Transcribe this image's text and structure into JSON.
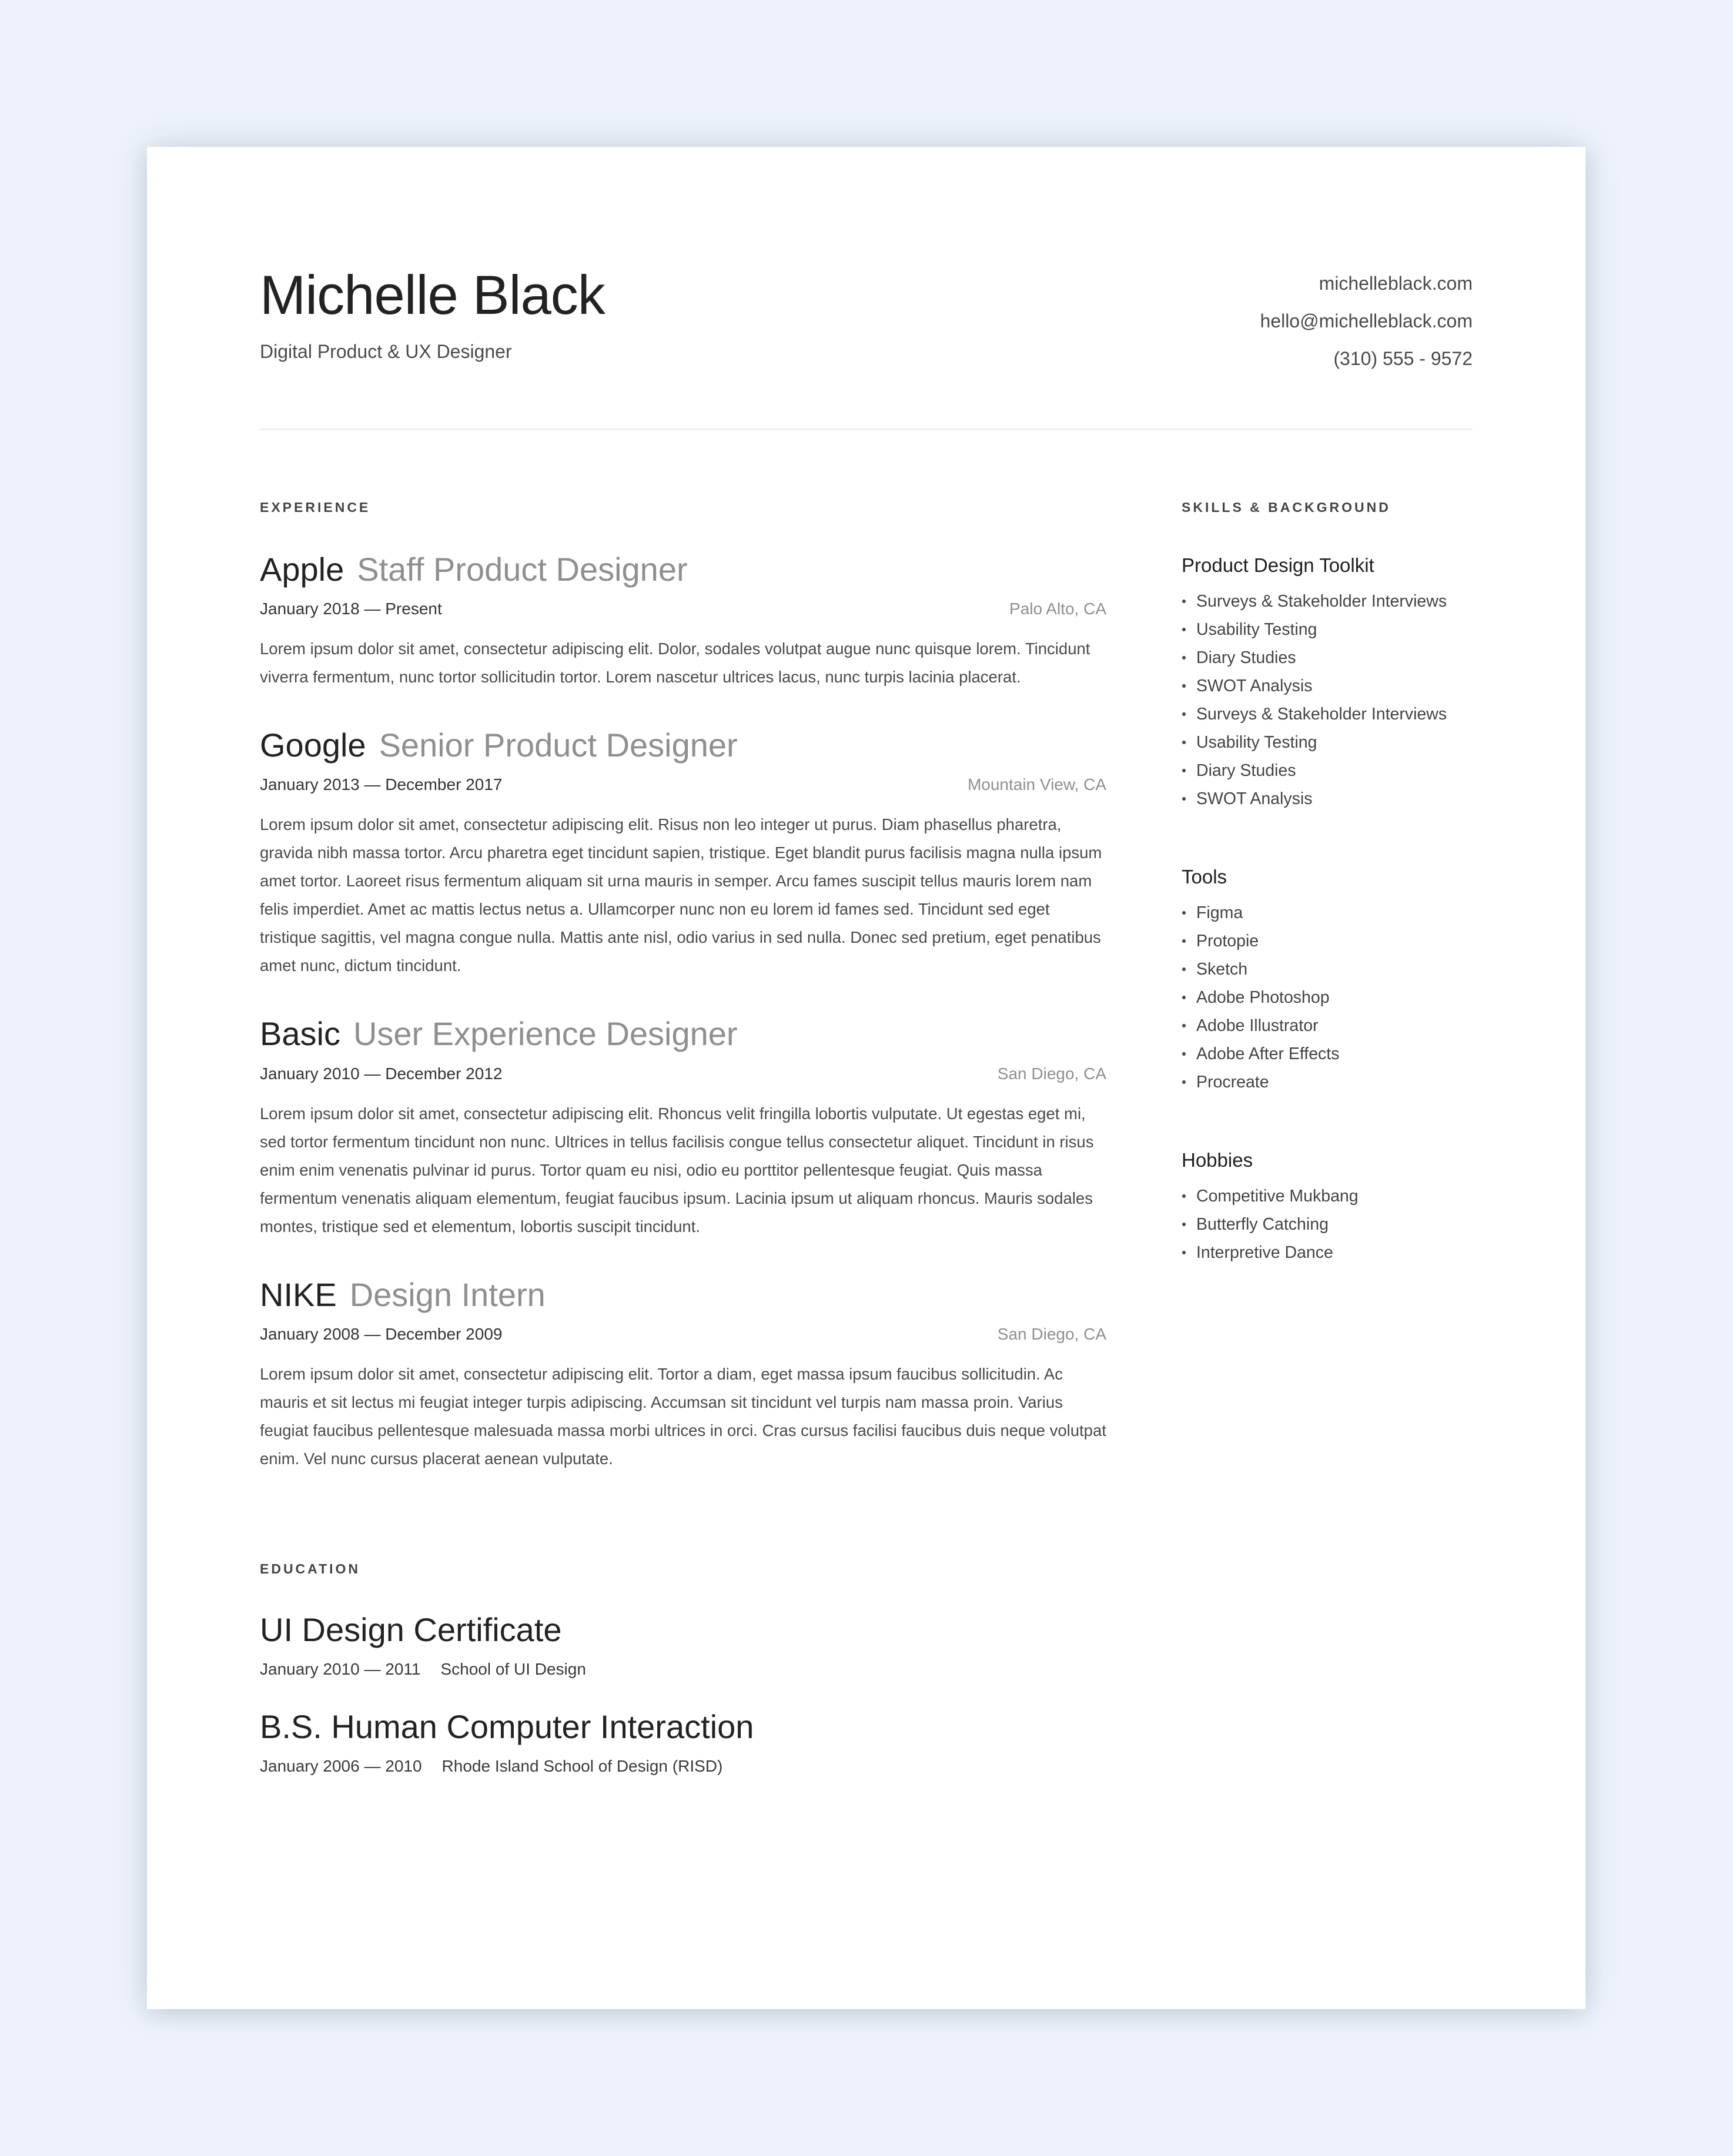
{
  "header": {
    "name": "Michelle Black",
    "subtitle": "Digital Product & UX Designer",
    "contact": {
      "website": "michelleblack.com",
      "email": "hello@michelleblack.com",
      "phone": "(310) 555 - 9572"
    }
  },
  "experience": {
    "label": "Experience",
    "jobs": [
      {
        "company": "Apple",
        "role": "Staff Product Designer",
        "dates": "January 2018 — Present",
        "location": "Palo Alto, CA",
        "description": "Lorem ipsum dolor sit amet, consectetur adipiscing elit. Dolor, sodales volutpat augue nunc quisque lorem. Tincidunt viverra fermentum, nunc tortor sollicitudin tortor. Lorem nascetur ultrices lacus, nunc turpis lacinia placerat."
      },
      {
        "company": "Google",
        "role": "Senior Product Designer",
        "dates": "January 2013 — December 2017",
        "location": "Mountain View, CA",
        "description": "Lorem ipsum dolor sit amet, consectetur adipiscing elit. Risus non leo integer ut purus. Diam phasellus pharetra, gravida nibh massa tortor. Arcu pharetra eget tincidunt sapien, tristique. Eget blandit purus facilisis magna nulla ipsum amet tortor. Laoreet risus fermentum aliquam sit urna mauris in semper. Arcu fames suscipit tellus mauris lorem nam felis imperdiet. Amet ac mattis lectus netus a. Ullamcorper nunc non eu lorem id fames sed. Tincidunt sed eget tristique sagittis, vel magna congue nulla. Mattis ante nisl, odio varius in sed nulla. Donec sed pretium, eget penatibus amet nunc, dictum tincidunt."
      },
      {
        "company": "Basic",
        "role": "User Experience Designer",
        "dates": "January 2010 — December 2012",
        "location": "San Diego, CA",
        "description": "Lorem ipsum dolor sit amet, consectetur adipiscing elit. Rhoncus velit fringilla lobortis vulputate. Ut egestas eget mi, sed tortor fermentum tincidunt non nunc. Ultrices in tellus facilisis congue tellus consectetur aliquet. Tincidunt in risus enim enim venenatis pulvinar id purus. Tortor quam eu nisi, odio eu porttitor pellentesque feugiat. Quis massa fermentum venenatis aliquam elementum, feugiat faucibus ipsum. Lacinia ipsum ut aliquam rhoncus. Mauris sodales montes, tristique sed et elementum, lobortis suscipit tincidunt."
      },
      {
        "company": "NIKE",
        "role": "Design Intern",
        "dates": "January 2008 — December 2009",
        "location": "San Diego, CA",
        "description": "Lorem ipsum dolor sit amet, consectetur adipiscing elit. Tortor a diam, eget massa ipsum faucibus sollicitudin. Ac mauris et sit lectus mi feugiat integer turpis adipiscing. Accumsan sit tincidunt vel turpis nam massa proin. Varius feugiat faucibus pellentesque malesuada massa morbi ultrices in orci. Cras cursus facilisi faucibus duis neque volutpat enim. Vel nunc cursus placerat aenean vulputate."
      }
    ]
  },
  "education": {
    "label": "Education",
    "items": [
      {
        "title": "UI Design Certificate",
        "dates": "January 2010 — 2011",
        "school": "School of UI Design"
      },
      {
        "title": "B.S. Human Computer Interaction",
        "dates": "January 2006 — 2010",
        "school": "Rhode Island School of Design (RISD)"
      }
    ]
  },
  "skills": {
    "label": "Skills & Background",
    "groups": [
      {
        "heading": "Product Design Toolkit",
        "items": [
          "Surveys & Stakeholder Interviews",
          "Usability Testing",
          "Diary Studies",
          "SWOT Analysis",
          "Surveys & Stakeholder Interviews",
          "Usability Testing",
          "Diary Studies",
          "SWOT Analysis"
        ]
      },
      {
        "heading": "Tools",
        "items": [
          "Figma",
          "Protopie",
          "Sketch",
          "Adobe Photoshop",
          "Adobe Illustrator",
          "Adobe After Effects",
          "Procreate"
        ]
      },
      {
        "heading": "Hobbies",
        "items": [
          "Competitive Mukbang",
          "Butterfly Catching",
          "Interpretive Dance"
        ]
      }
    ]
  },
  "colors": {
    "background": "#eef3fb",
    "card": "#ffffff",
    "text_primary": "#222222",
    "text_muted": "#8f8f8f",
    "body_text": "#4a4a4a"
  }
}
